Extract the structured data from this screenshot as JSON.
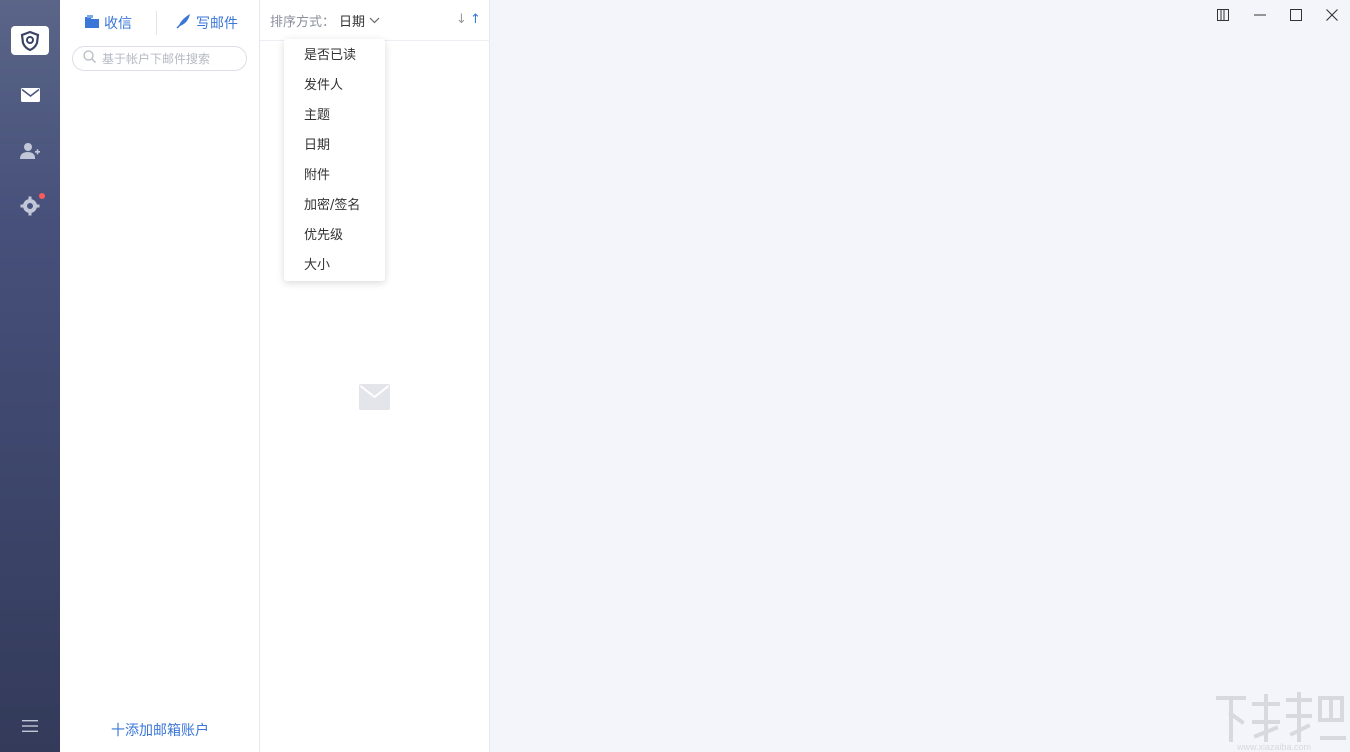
{
  "rail": {
    "items": [
      "mail-icon",
      "contacts-icon",
      "settings-icon",
      "menu-icon"
    ],
    "settings_badge_color": "#ff5b5b"
  },
  "accounts": {
    "receive_label": "收信",
    "compose_label": "写邮件",
    "search_placeholder": "基于帐户下邮件搜索",
    "add_account_label": "十添加邮箱账户"
  },
  "maillist": {
    "sort_label": "排序方式：",
    "sort_value": "日期",
    "sort_desc": "↓",
    "sort_asc": "↑"
  },
  "sort_menu": {
    "options": [
      "是否已读",
      "发件人",
      "主题",
      "日期",
      "附件",
      "加密/签名",
      "优先级",
      "大小"
    ]
  },
  "colors": {
    "accent": "#3a77d8",
    "rail_top": "#5a6588",
    "rail_bottom": "#333a5a",
    "background": "#f4f5fa"
  }
}
